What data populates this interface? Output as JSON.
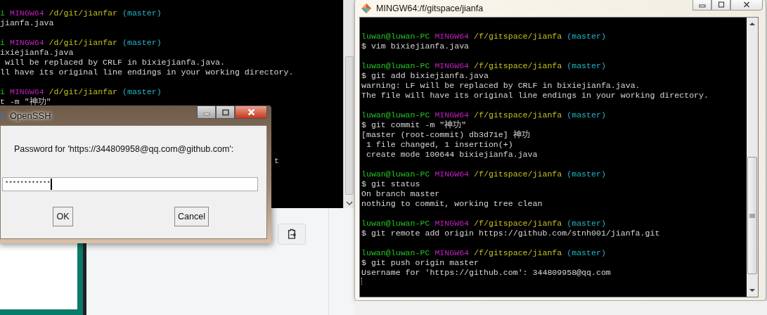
{
  "back_terminal": {
    "lines": [
      {
        "kind": "prompt",
        "user": "i",
        "host": "MINGW64",
        "path": "/d/git/jianfar",
        "branch": "(master)"
      },
      {
        "kind": "text",
        "text": "jianfa.java"
      },
      {
        "kind": "blank"
      },
      {
        "kind": "prompt",
        "user": "i",
        "host": "MINGW64",
        "path": "/d/git/jianfar",
        "branch": "(master)"
      },
      {
        "kind": "text",
        "text": "ixiejianfa.java"
      },
      {
        "kind": "text",
        "text": " will be replaced by CRLF in bixiejianfa.java."
      },
      {
        "kind": "text",
        "text": "ll have its original line endings in your working directory."
      },
      {
        "kind": "blank"
      },
      {
        "kind": "prompt",
        "user": "i",
        "host": "MINGW64",
        "path": "/d/git/jianfar",
        "branch": "(master)"
      },
      {
        "kind": "text",
        "text": "t -m \"神功\""
      },
      {
        "kind": "blank"
      },
      {
        "kind": "blank"
      },
      {
        "kind": "blank"
      },
      {
        "kind": "blank"
      },
      {
        "kind": "blank"
      },
      {
        "kind": "tail",
        "text": "t"
      }
    ]
  },
  "dialog": {
    "title": "OpenSSH",
    "prompt": "Password for 'https://344809958@qq.com@github.com':",
    "password": "************",
    "buttons": [
      "OK",
      "Cancel"
    ]
  },
  "terminal": {
    "title": "MINGW64:/f/gitspace/jianfa",
    "lines": [
      {
        "kind": "blank"
      },
      {
        "kind": "prompt",
        "user": "luwan@luwan-PC",
        "host": "MINGW64",
        "path": "/f/gitspace/jianfa",
        "branch": "(master)"
      },
      {
        "kind": "text",
        "text": "$ vim bixiejianfa.java"
      },
      {
        "kind": "blank"
      },
      {
        "kind": "prompt",
        "user": "luwan@luwan-PC",
        "host": "MINGW64",
        "path": "/f/gitspace/jianfa",
        "branch": "(master)"
      },
      {
        "kind": "text",
        "text": "$ git add bixiejianfa.java"
      },
      {
        "kind": "text",
        "text": "warning: LF will be replaced by CRLF in bixiejianfa.java."
      },
      {
        "kind": "text",
        "text": "The file will have its original line endings in your working directory."
      },
      {
        "kind": "blank"
      },
      {
        "kind": "prompt",
        "user": "luwan@luwan-PC",
        "host": "MINGW64",
        "path": "/f/gitspace/jianfa",
        "branch": "(master)"
      },
      {
        "kind": "text",
        "text": "$ git commit -m \"神功\""
      },
      {
        "kind": "text",
        "text": "[master (root-commit) db3d71e] 神功"
      },
      {
        "kind": "text",
        "text": " 1 file changed, 1 insertion(+)"
      },
      {
        "kind": "text",
        "text": " create mode 100644 bixiejianfa.java"
      },
      {
        "kind": "blank"
      },
      {
        "kind": "prompt",
        "user": "luwan@luwan-PC",
        "host": "MINGW64",
        "path": "/f/gitspace/jianfa",
        "branch": "(master)"
      },
      {
        "kind": "text",
        "text": "$ git status"
      },
      {
        "kind": "text",
        "text": "On branch master"
      },
      {
        "kind": "text",
        "text": "nothing to commit, working tree clean"
      },
      {
        "kind": "blank"
      },
      {
        "kind": "prompt",
        "user": "luwan@luwan-PC",
        "host": "MINGW64",
        "path": "/f/gitspace/jianfa",
        "branch": "(master)"
      },
      {
        "kind": "text",
        "text": "$ git remote add origin https://github.com/stnh001/jianfa.git"
      },
      {
        "kind": "blank"
      },
      {
        "kind": "prompt",
        "user": "luwan@luwan-PC",
        "host": "MINGW64",
        "path": "/f/gitspace/jianfa",
        "branch": "(master)"
      },
      {
        "kind": "text",
        "text": "$ git push origin master"
      },
      {
        "kind": "text",
        "text": "Username for 'https://github.com': 344809958@qq.com"
      },
      {
        "kind": "cursor"
      }
    ]
  }
}
